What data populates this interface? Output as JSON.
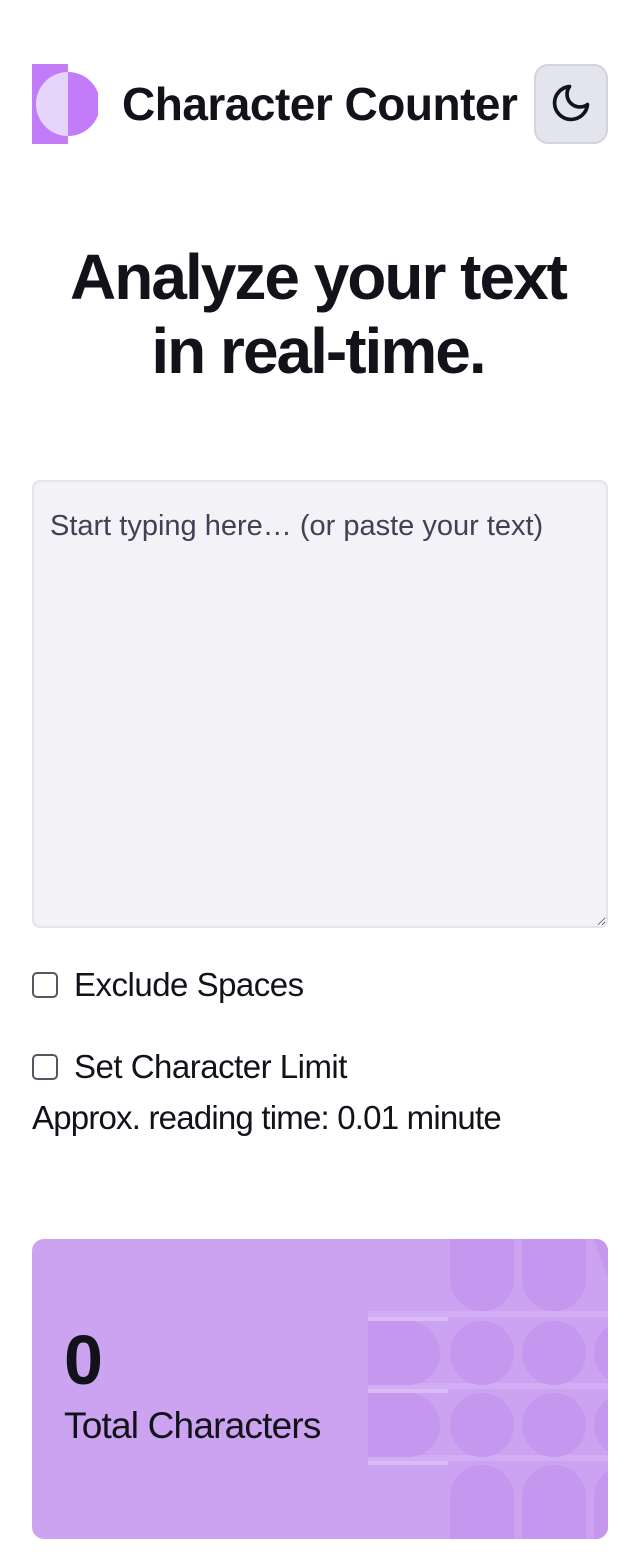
{
  "header": {
    "title": "Character Counter",
    "logo_icon": "half-circle-logo",
    "theme_toggle_icon": "moon-icon"
  },
  "hero": {
    "line1": "Analyze your text",
    "line2": "in real-time."
  },
  "editor": {
    "value": "",
    "placeholder": "Start typing here… (or paste your text)"
  },
  "options": {
    "exclude_spaces_label": "Exclude Spaces",
    "exclude_spaces_checked": false,
    "character_limit_label": "Set Character Limit",
    "character_limit_checked": false
  },
  "reading_time": "Approx. reading time: 0.01 minute",
  "stats": {
    "total_characters_value": "0",
    "total_characters_label": "Total Characters"
  },
  "colors": {
    "accent": "#c27cf8",
    "card": "#cba3f1",
    "editor_bg": "#f2f2f7",
    "toggle_bg": "#e4e4ef",
    "text": "#12131a"
  }
}
